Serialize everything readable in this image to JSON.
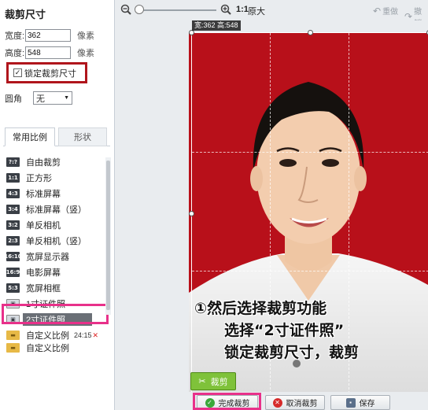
{
  "sidebar": {
    "title": "裁剪尺寸",
    "width_label": "宽度:",
    "width_value": "362",
    "height_label": "高度:",
    "height_value": "548",
    "unit": "像素",
    "lock_label": "锁定裁剪尺寸",
    "corner_label": "圆角",
    "corner_value": "无",
    "tabs": [
      {
        "label": "常用比例"
      },
      {
        "label": "形状"
      }
    ],
    "ratio_items": [
      {
        "icon": "?:?",
        "label": "自由裁剪"
      },
      {
        "icon": "1:1",
        "label": "正方形"
      },
      {
        "icon": "4:3",
        "label": "标准屏幕"
      },
      {
        "icon": "3:4",
        "label": "标准屏幕（竖）"
      },
      {
        "icon": "3:2",
        "label": "单反相机"
      },
      {
        "icon": "2:3",
        "label": "单反相机（竖）"
      },
      {
        "icon": "16:10",
        "label": "宽屏显示器"
      },
      {
        "icon": "16:9",
        "label": "电影屏幕"
      },
      {
        "icon": "5:3",
        "label": "宽屏相框"
      },
      {
        "icon": "",
        "label": "1寸证件照"
      },
      {
        "icon": "",
        "label": "2寸证件照"
      },
      {
        "icon": "",
        "label": "自定义比例",
        "extra": "24:15"
      },
      {
        "icon": "",
        "label": "自定义比例"
      }
    ]
  },
  "toolbar": {
    "ratio_11": "1:1",
    "original": "原大",
    "redo": "重做",
    "undo": "撤销"
  },
  "canvas": {
    "dimension_readout": "宽:362 高:548"
  },
  "annotation": {
    "line1": "①然后选择裁剪功能",
    "line2": "选择“2寸证件照”",
    "line3": "锁定裁剪尺寸，裁剪"
  },
  "buttons": {
    "crop": "裁剪",
    "finish": "完成裁剪",
    "cancel": "取消裁剪",
    "save": "保存"
  },
  "colors": {
    "photo_background": "#b8101a",
    "highlight_red": "#b0151c",
    "highlight_pink": "#e8318a",
    "crop_green": "#7fc23a"
  }
}
